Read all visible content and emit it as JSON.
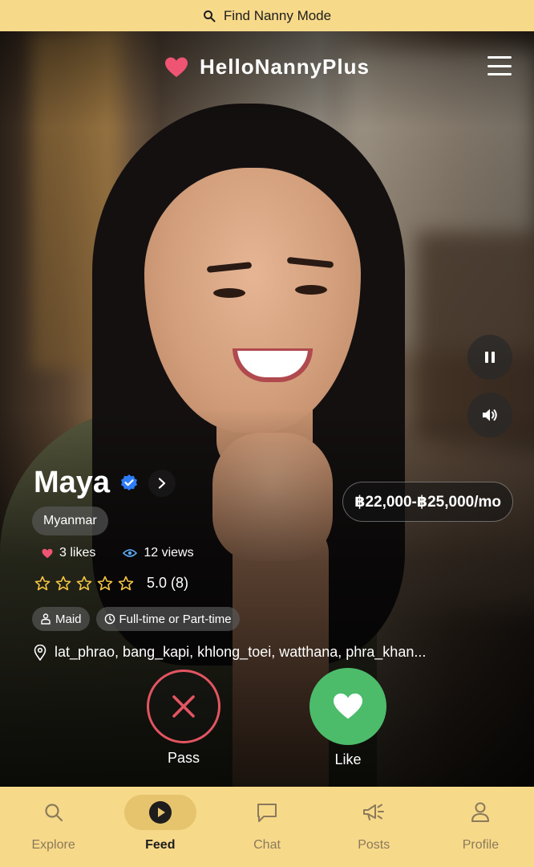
{
  "mode_bar": {
    "label": "Find Nanny Mode",
    "icon": "search-icon"
  },
  "header": {
    "brand": "HelloNannyPlus",
    "brand_icon": "heart-icon",
    "menu_icon": "hamburger-menu-icon"
  },
  "media_controls": {
    "pause_icon": "pause-icon",
    "volume_icon": "volume-icon"
  },
  "profile": {
    "name": "Maya",
    "verified_icon": "verified-badge-icon",
    "country": "Myanmar",
    "salary": "฿22,000-฿25,000/mo",
    "likes": "3 likes",
    "views": "12 views",
    "rating_text": "5.0 (8)",
    "stars": 5,
    "tags": [
      {
        "icon": "person-icon",
        "label": "Maid"
      },
      {
        "icon": "clock-icon",
        "label": "Full-time or Part-time"
      }
    ],
    "location": "lat_phrao, bang_kapi, khlong_toei, watthana, phra_khan..."
  },
  "actions": {
    "pass_label": "Pass",
    "like_label": "Like"
  },
  "bottom_nav": [
    {
      "label": "Explore",
      "icon": "search-icon",
      "active": false
    },
    {
      "label": "Feed",
      "icon": "play-icon",
      "active": true
    },
    {
      "label": "Chat",
      "icon": "chat-bubble-icon",
      "active": false
    },
    {
      "label": "Posts",
      "icon": "megaphone-icon",
      "active": false
    },
    {
      "label": "Profile",
      "icon": "user-icon",
      "active": false
    }
  ],
  "colors": {
    "accent_yellow": "#f7d98a",
    "pass_red": "#e35561",
    "like_green": "#4cbc6b",
    "heart_pink": "#ef5573",
    "verified_blue": "#2d7df6"
  }
}
